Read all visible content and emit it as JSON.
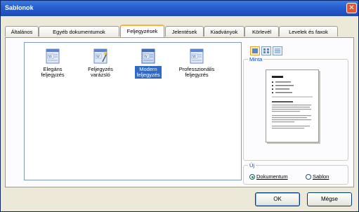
{
  "window": {
    "title": "Sablonok"
  },
  "tabs": [
    {
      "label": "Általános"
    },
    {
      "label": "Egyéb dokumentumok"
    },
    {
      "label": "Feljegyzések",
      "active": true
    },
    {
      "label": "Jelentések"
    },
    {
      "label": "Kiadványok"
    },
    {
      "label": "Körlevél"
    },
    {
      "label": "Levelek és faxok"
    }
  ],
  "templates": [
    {
      "line1": "Elegáns",
      "line2": "feljegyzés",
      "icon": "document-template-icon"
    },
    {
      "line1": "Feljegyzés",
      "line2": "varázsló",
      "icon": "wizard-template-icon"
    },
    {
      "line1": "Modern",
      "line2": "feljegyzés",
      "icon": "document-template-icon",
      "selected": true
    },
    {
      "line1": "Professzionális",
      "line2": "feljegyzés",
      "icon": "document-template-icon"
    }
  ],
  "preview": {
    "label": "Minta"
  },
  "new_group": {
    "label": "Új",
    "option_document": "Dokumentum",
    "option_template": "Sablon",
    "selected": "Dokumentum"
  },
  "buttons": {
    "ok": "OK",
    "cancel": "Mégse"
  },
  "colors": {
    "title_bar": "#2a5fd0",
    "selection": "#316ac5",
    "active_tab_accent": "#f9b23a"
  }
}
